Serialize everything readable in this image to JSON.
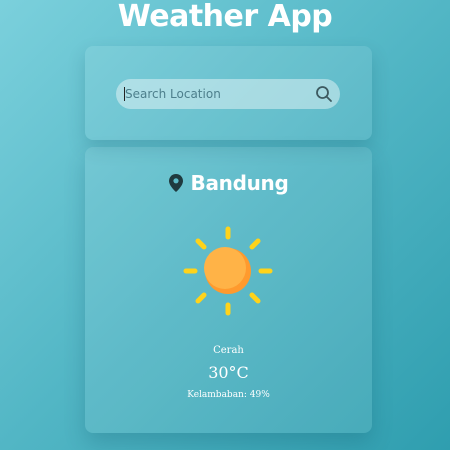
{
  "app": {
    "title": "Weather App"
  },
  "search": {
    "placeholder": "Search Location",
    "value": "",
    "icon": "search-icon"
  },
  "weather": {
    "location": "Bandung",
    "location_icon": "map-pin-icon",
    "condition_icon": "sun-icon",
    "condition": "Cerah",
    "temperature": "30°C",
    "humidity": "Kelambaban: 49%"
  },
  "colors": {
    "background_start": "#7bd0dc",
    "background_end": "#2f9eaf",
    "sun_core": "#ffb347",
    "sun_core_shade": "#ff9a2e",
    "sun_rays": "#ffd31a",
    "text": "#ffffff",
    "pin": "#1f3a3f"
  }
}
